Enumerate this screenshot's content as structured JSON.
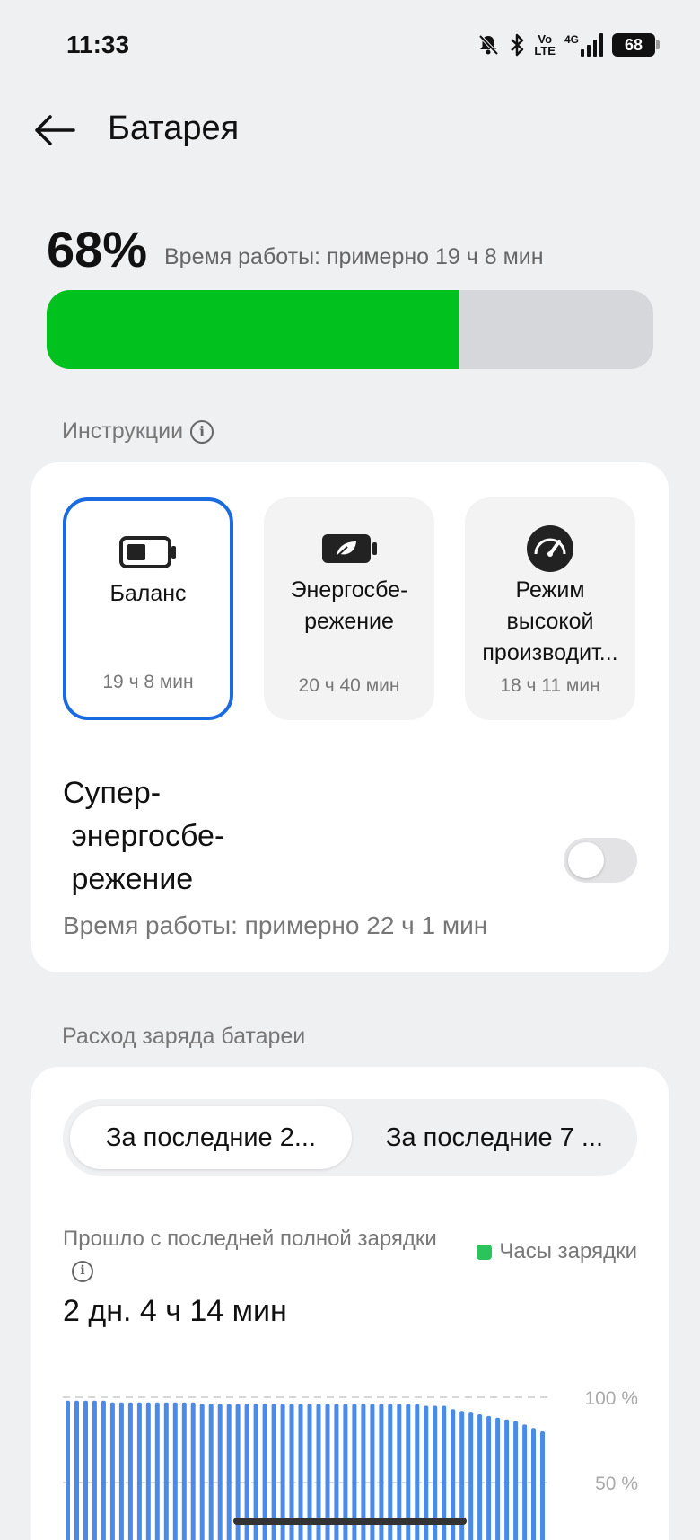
{
  "status_bar": {
    "time": "11:33",
    "icons": [
      "mute-bell-icon",
      "bluetooth-icon",
      "volte-icon",
      "4g-signal-icon",
      "battery-icon"
    ],
    "volte_top": "Vo",
    "volte_bottom": "LTE",
    "network": "4G",
    "battery": "68"
  },
  "header": {
    "title": "Батарея"
  },
  "battery": {
    "percent_label": "68%",
    "level": 0.68,
    "runtime": "Время работы: примерно 19 ч 8 мин",
    "fill_color": "#00c11e"
  },
  "instructions": {
    "label": "Инструкции",
    "modes": [
      {
        "name": "Баланс",
        "time": "19 ч 8 мин",
        "icon": "battery-half-icon",
        "selected": true
      },
      {
        "name": "Энергосбе-\nрежение",
        "time": "20 ч 40 мин",
        "icon": "leaf-battery-icon",
        "selected": false
      },
      {
        "name": "Режим\nвысокой\nпроизводит...",
        "time": "18 ч 11 мин",
        "icon": "speedometer-icon",
        "selected": false
      }
    ],
    "super_saver": {
      "title": "Супер-\n энергосбе-\n режение",
      "runtime": "Время работы: примерно 22 ч 1 мин",
      "enabled": false
    }
  },
  "usage": {
    "label": "Расход заряда батареи",
    "tabs": [
      "За последние 2...",
      "За последние 7 ..."
    ],
    "active_tab": 0,
    "since_label": "Прошло с последней полной зарядки",
    "since_value": "2 дн. 4 ч 14 мин",
    "legend": "Часы зарядки",
    "accent": "#4a8ae8",
    "legend_color": "#2bc45c"
  },
  "chart_data": {
    "type": "bar",
    "y_ticks": [
      "100 %",
      "50 %"
    ],
    "ylim": [
      0,
      100
    ],
    "values": [
      98,
      98,
      98,
      98,
      98,
      97,
      97,
      97,
      97,
      97,
      97,
      97,
      97,
      97,
      97,
      96,
      96,
      96,
      96,
      96,
      96,
      96,
      96,
      96,
      96,
      96,
      96,
      96,
      96,
      96,
      96,
      96,
      96,
      96,
      96,
      96,
      96,
      96,
      96,
      96,
      95,
      95,
      95,
      93,
      92,
      91,
      90,
      89,
      88,
      87,
      86,
      84,
      82,
      80
    ]
  }
}
